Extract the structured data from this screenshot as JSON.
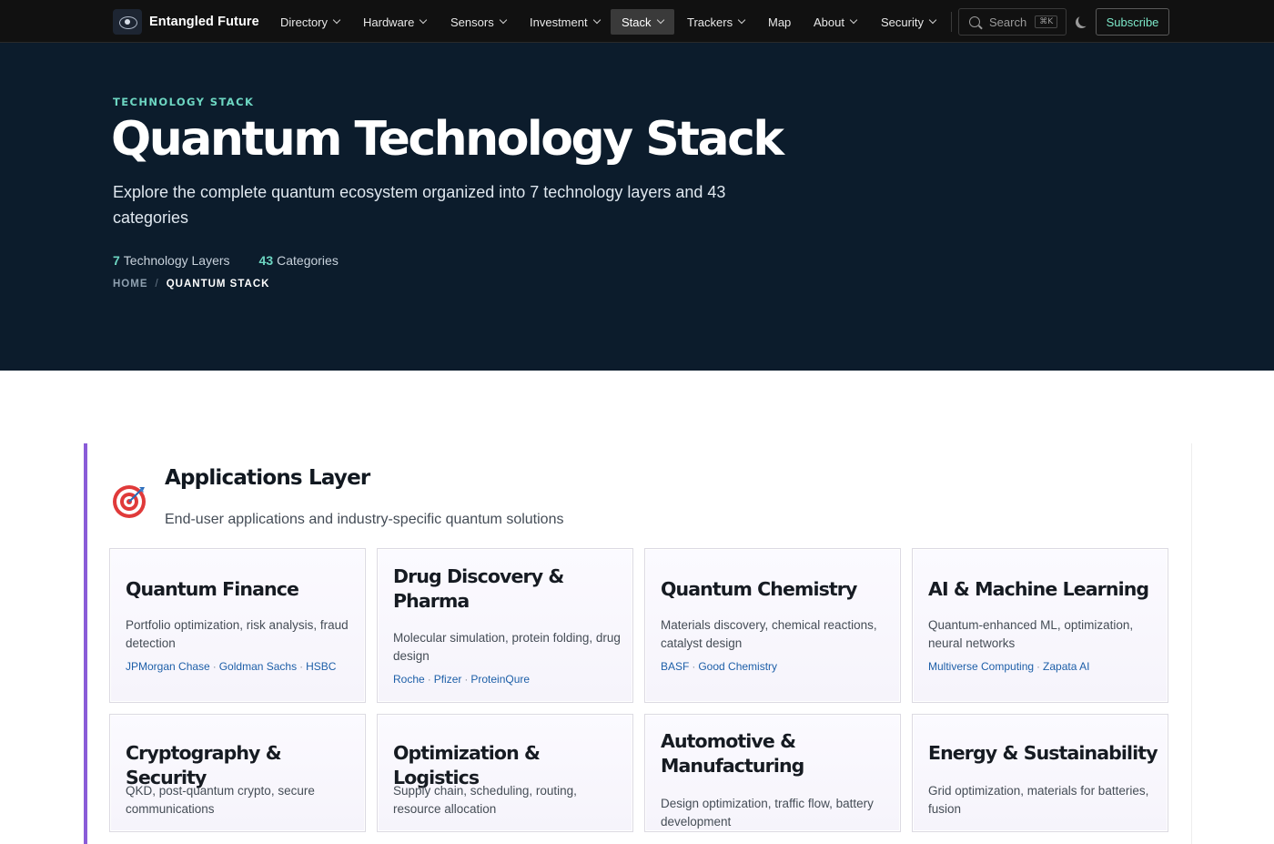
{
  "nav": {
    "brand": "Entangled Future",
    "items": [
      {
        "label": "Directory",
        "dropdown": true
      },
      {
        "label": "Hardware",
        "dropdown": true
      },
      {
        "label": "Sensors",
        "dropdown": true
      },
      {
        "label": "Investment",
        "dropdown": true
      },
      {
        "label": "Stack",
        "dropdown": true,
        "active": true
      },
      {
        "label": "Trackers",
        "dropdown": true
      },
      {
        "label": "Map",
        "dropdown": false
      },
      {
        "label": "About",
        "dropdown": true
      },
      {
        "label": "Security",
        "dropdown": true
      }
    ],
    "search_label": "Search",
    "search_shortcut": "⌘K",
    "subscribe_label": "Subscribe"
  },
  "hero": {
    "eyebrow": "TECHNOLOGY STACK",
    "title": "Quantum Technology Stack",
    "subtitle": "Explore the complete quantum ecosystem organized into 7 technology layers and 43 categories",
    "stats": [
      {
        "value": "7",
        "label": "Technology Layers"
      },
      {
        "value": "43",
        "label": "Categories"
      }
    ],
    "breadcrumb": {
      "home": "HOME",
      "separator": "/",
      "current": "QUANTUM STACK"
    }
  },
  "layer": {
    "icon": "target-icon",
    "accent_color": "#8a5cd8",
    "title": "Applications Layer",
    "description": "End-user applications and industry-specific quantum solutions",
    "cards": [
      {
        "title": "Quantum Finance",
        "description": "Portfolio optimization, risk analysis, fraud detection",
        "companies": [
          "JPMorgan Chase",
          "Goldman Sachs",
          "HSBC"
        ]
      },
      {
        "title": "Drug Discovery & Pharma",
        "description": "Molecular simulation, protein folding, drug design",
        "companies": [
          "Roche",
          "Pfizer",
          "ProteinQure"
        ]
      },
      {
        "title": "Quantum Chemistry",
        "description": "Materials discovery, chemical reactions, catalyst design",
        "companies": [
          "BASF",
          "Good Chemistry"
        ]
      },
      {
        "title": "AI & Machine Learning",
        "description": "Quantum-enhanced ML, optimization, neural networks",
        "companies": [
          "Multiverse Computing",
          "Zapata AI"
        ]
      },
      {
        "title": "Cryptography & Security",
        "description": "QKD, post-quantum crypto, secure communications",
        "companies": []
      },
      {
        "title": "Optimization & Logistics",
        "description": "Supply chain, scheduling, routing, resource allocation",
        "companies": []
      },
      {
        "title": "Automotive & Manufacturing",
        "description": "Design optimization, traffic flow, battery development",
        "companies": []
      },
      {
        "title": "Energy & Sustainability",
        "description": "Grid optimization, materials for batteries, fusion",
        "companies": []
      }
    ]
  },
  "colors": {
    "nav_bg": "#111111",
    "hero_bg": "#0c1c2c",
    "accent_teal": "#6dd6c2",
    "link_blue": "#1d5fa8"
  }
}
